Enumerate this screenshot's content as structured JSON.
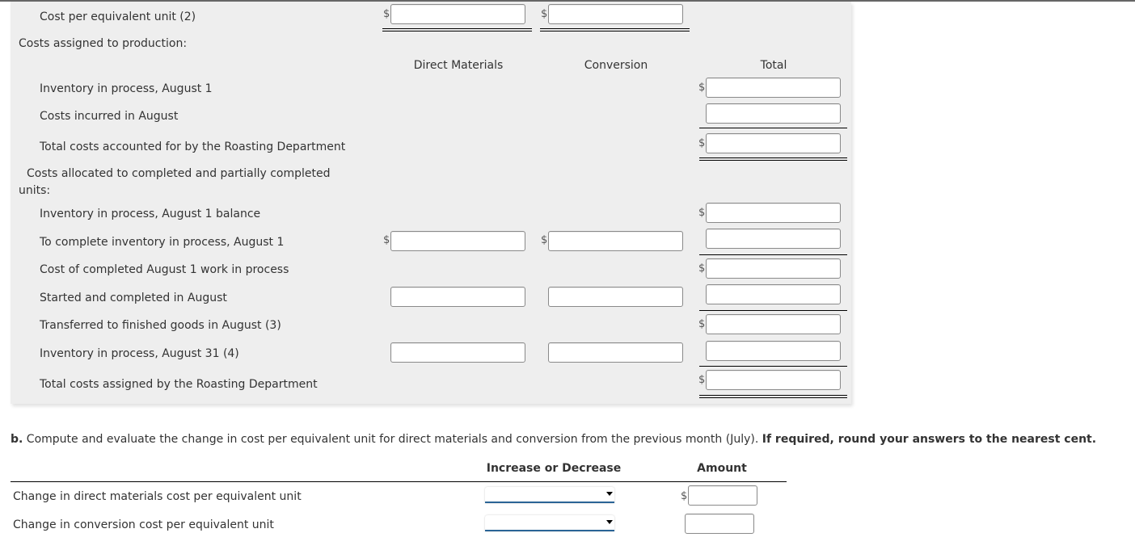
{
  "part_a": {
    "cost_per_equivalent_unit_label": "Cost per equivalent unit (2)",
    "costs_assigned_heading": "Costs assigned to production:",
    "columns": {
      "direct_materials": "Direct Materials",
      "conversion": "Conversion",
      "total": "Total"
    },
    "rows": {
      "inventory_aug1": "Inventory in process, August 1",
      "costs_incurred": "Costs incurred in August",
      "total_accounted": "Total costs accounted for by the Roasting Department",
      "allocated_heading_line1": "Costs allocated to completed and partially completed",
      "allocated_heading_line2": "units:",
      "inventory_aug1_balance": "Inventory in process, August 1 balance",
      "to_complete": "To complete inventory in process, August 1",
      "cost_completed": "Cost of completed August 1 work in process",
      "started_completed": "Started and completed in August",
      "transferred": "Transferred to finished goods in August (3)",
      "inventory_aug31": "Inventory in process, August 31 (4)",
      "total_assigned": "Total costs assigned by the Roasting Department"
    },
    "currency_symbol": "$"
  },
  "part_b": {
    "prefix": "b.",
    "prompt": "Compute and evaluate the change in cost per equivalent unit for direct materials and conversion from the previous month (July).",
    "instruction": "If required, round your answers to the nearest cent.",
    "columns": {
      "increase_decrease": "Increase or Decrease",
      "amount": "Amount"
    },
    "rows": [
      {
        "label": "Change in direct materials cost per equivalent unit",
        "selected": "",
        "amount": ""
      },
      {
        "label": "Change in conversion cost per equivalent unit",
        "selected": "",
        "amount": ""
      }
    ]
  }
}
